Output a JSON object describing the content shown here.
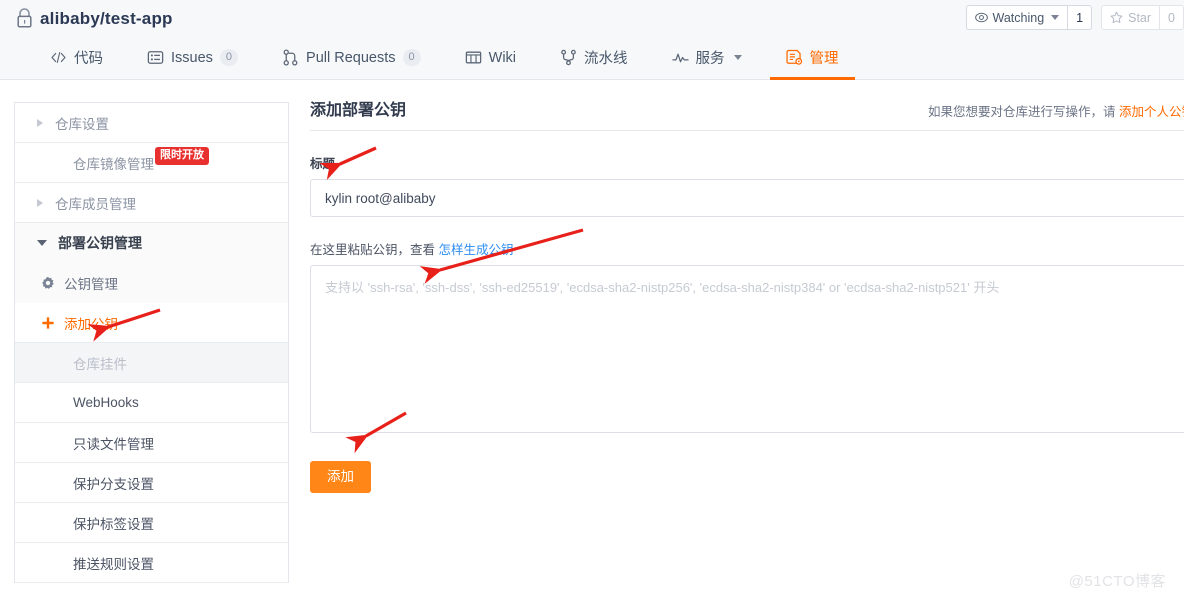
{
  "header": {
    "repo_name": "alibaby/test-app",
    "lock_icon": "lock-icon",
    "watching_label": "Watching",
    "watching_count": "1",
    "star_label": "Star",
    "star_count": "0"
  },
  "nav": {
    "tabs": [
      {
        "label": "代码",
        "icon": "code-icon",
        "count": null,
        "active": false,
        "dropdown": false
      },
      {
        "label": "Issues",
        "icon": "issues-icon",
        "count": "0",
        "active": false,
        "dropdown": false
      },
      {
        "label": "Pull Requests",
        "icon": "pull-request-icon",
        "count": "0",
        "active": false,
        "dropdown": false
      },
      {
        "label": "Wiki",
        "icon": "wiki-icon",
        "count": null,
        "active": false,
        "dropdown": false
      },
      {
        "label": "流水线",
        "icon": "pipeline-icon",
        "count": null,
        "active": false,
        "dropdown": false
      },
      {
        "label": "服务",
        "icon": "service-icon",
        "count": null,
        "active": false,
        "dropdown": true
      },
      {
        "label": "管理",
        "icon": "manage-icon",
        "count": null,
        "active": true,
        "dropdown": false
      }
    ]
  },
  "sidebar": {
    "items": [
      {
        "label": "仓库设置",
        "type": "collapsed-group",
        "icon": "chevron-right-icon"
      },
      {
        "label": "仓库镜像管理",
        "type": "plain",
        "badge": "限时开放"
      },
      {
        "label": "仓库成员管理",
        "type": "collapsed-group",
        "icon": "chevron-right-icon"
      },
      {
        "label": "部署公钥管理",
        "type": "expanded-group",
        "icon": "chevron-down-icon"
      },
      {
        "label": "公钥管理",
        "type": "sub",
        "icon": "gear-icon"
      },
      {
        "label": "添加公钥",
        "type": "sub-accent",
        "icon": "plus-icon"
      },
      {
        "label": "仓库挂件",
        "type": "section-head"
      },
      {
        "label": "WebHooks",
        "type": "dark"
      },
      {
        "label": "只读文件管理",
        "type": "dark"
      },
      {
        "label": "保护分支设置",
        "type": "dark"
      },
      {
        "label": "保护标签设置",
        "type": "dark"
      },
      {
        "label": "推送规则设置",
        "type": "dark"
      }
    ]
  },
  "main": {
    "title": "添加部署公钥",
    "hint_text": "如果您想要对仓库进行写操作，请 ",
    "hint_link": "添加个人公钥",
    "title_field": {
      "label": "标题",
      "value": "kylin root@alibaby"
    },
    "key_field": {
      "label_prefix": "在这里粘贴公钥，查看 ",
      "label_link": "怎样生成公钥",
      "placeholder": "支持以 'ssh-rsa', 'ssh-dss', 'ssh-ed25519', 'ecdsa-sha2-nistp256', 'ecdsa-sha2-nistp384' or 'ecdsa-sha2-nistp521' 开头",
      "value": ""
    },
    "submit_label": "添加"
  },
  "watermark": "@51CTO博客",
  "colors": {
    "accent_orange": "#ff6a00",
    "button_orange": "#ff8617",
    "badge_red": "#e8302f",
    "link_blue": "#2d8cf0",
    "annotation_red": "#e8201a"
  }
}
